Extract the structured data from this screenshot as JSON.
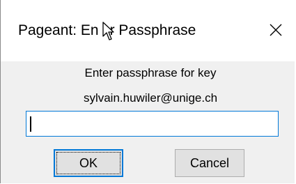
{
  "dialog": {
    "title": "Pageant: Enter Passphrase",
    "title_visible": "Pageant: En",
    "title_visible_end": "r Passphrase",
    "close_icon": "close-icon",
    "message_line1": "Enter passphrase for key",
    "message_line2": "sylvain.huwiler@unige.ch",
    "passphrase_value": "",
    "ok_label": "OK",
    "cancel_label": "Cancel"
  },
  "colors": {
    "focus_border": "#0078d7",
    "client_background": "#f0f0f0",
    "button_face": "#e1e1e1"
  }
}
